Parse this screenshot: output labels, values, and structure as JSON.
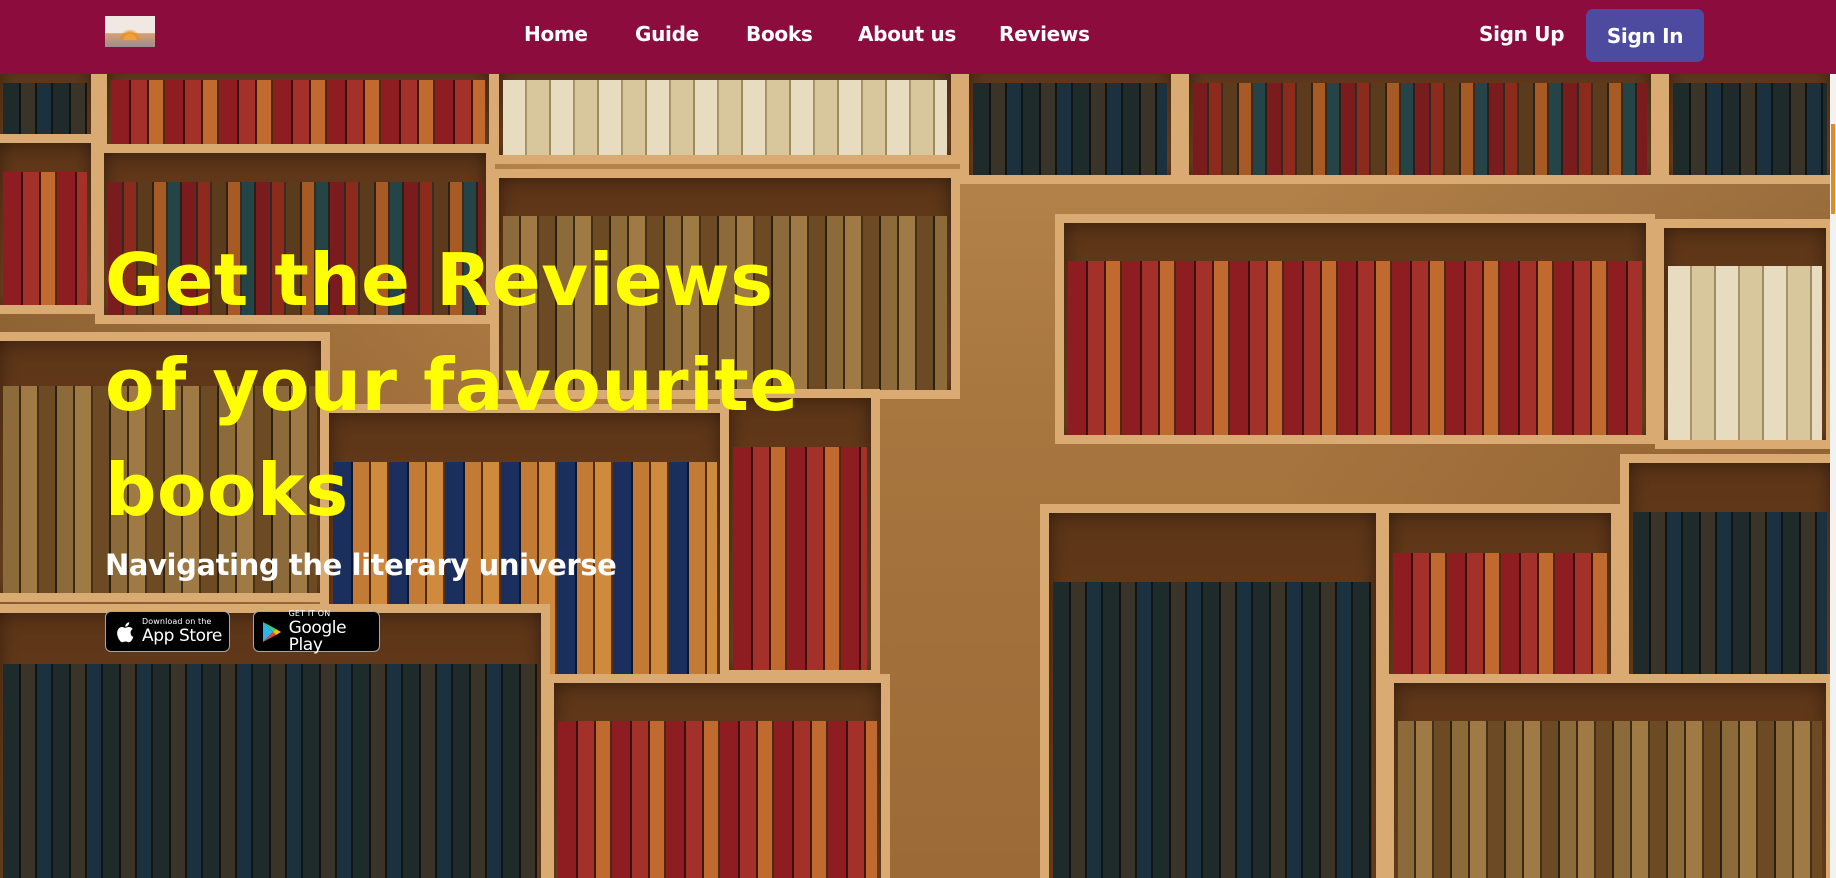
{
  "nav": {
    "links": [
      {
        "label": "Home"
      },
      {
        "label": "Guide"
      },
      {
        "label": "Books"
      },
      {
        "label": "About us"
      },
      {
        "label": "Reviews"
      }
    ],
    "signup_label": "Sign Up",
    "signin_label": "Sign In",
    "logo_icon": "book-sunrise-logo"
  },
  "hero": {
    "headline_lines": [
      "Get the Reviews",
      "of your favourite",
      "books"
    ],
    "tagline": "Navigating the literary universe",
    "stores": {
      "appstore": {
        "small": "Download on the",
        "big": "App Store",
        "icon": "apple-icon"
      },
      "googleplay": {
        "small": "GET IT ON",
        "big": "Google Play",
        "icon": "google-play-icon"
      }
    }
  },
  "colors": {
    "nav_bg": "#8b0c3d",
    "signin_bg": "#4c4ba0",
    "headline": "#ffff00",
    "tagline": "#ffffff"
  }
}
